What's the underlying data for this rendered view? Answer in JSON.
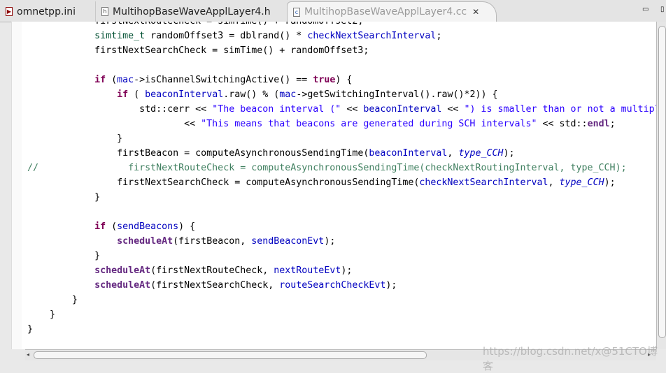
{
  "tabs": [
    {
      "label": "omnetpp.ini",
      "icon": "ini-file-icon",
      "glyph": "▶"
    },
    {
      "label": "MultihopBaseWaveApplLayer4.h",
      "icon": "header-file-icon",
      "glyph": "h"
    },
    {
      "label": "MultihopBaseWaveApplLayer4.cc",
      "icon": "cpp-file-icon",
      "glyph": "c",
      "active": true,
      "close_glyph": "✕"
    }
  ],
  "window_controls": {
    "minimize": "▭",
    "maximize": "▯"
  },
  "colors": {
    "keyword": "#7f0055",
    "field": "#0000c0",
    "string": "#2a00ff",
    "comment": "#3f7f5f",
    "type": "#005032"
  },
  "code_lines": [
    [
      [
        "",
        "            firstNextRouteCheck = simTime() + randomOffset2;"
      ]
    ],
    [
      [
        "",
        "            "
      ],
      [
        "typ",
        "simtime_t"
      ],
      [
        "",
        " randomOffset3 = dblrand() * "
      ],
      [
        "fld",
        "checkNextSearchInterval"
      ],
      [
        "",
        ";"
      ]
    ],
    [
      [
        "",
        "            firstNextSearchCheck = simTime() + randomOffset3;"
      ]
    ],
    [],
    [
      [
        "",
        "            "
      ],
      [
        "kw",
        "if"
      ],
      [
        "",
        " ("
      ],
      [
        "fld",
        "mac"
      ],
      [
        "",
        "->isChannelSwitchingActive() == "
      ],
      [
        "kw",
        "true"
      ],
      [
        "",
        ") {"
      ]
    ],
    [
      [
        "",
        "                "
      ],
      [
        "kw",
        "if"
      ],
      [
        "",
        " ( "
      ],
      [
        "fld",
        "beaconInterval"
      ],
      [
        "",
        ".raw() % ("
      ],
      [
        "fld",
        "mac"
      ],
      [
        "",
        "->getSwitchingInterval().raw()*2)) {"
      ]
    ],
    [
      [
        "",
        "                    std::cerr << "
      ],
      [
        "str",
        "\"The beacon interval (\""
      ],
      [
        "",
        " << "
      ],
      [
        "fld",
        "beaconInterval"
      ],
      [
        "",
        " << "
      ],
      [
        "str",
        "\") is smaller than or not a multiple of one synchronization interval (\""
      ]
    ],
    [
      [
        "",
        "                            << "
      ],
      [
        "str",
        "\"This means that beacons are generated during SCH intervals\""
      ],
      [
        "",
        " << std::"
      ],
      [
        "fn",
        "endl"
      ],
      [
        "",
        ";"
      ]
    ],
    [
      [
        "",
        "                }"
      ]
    ],
    [
      [
        "",
        "                firstBeacon = computeAsynchronousSendingTime("
      ],
      [
        "fld",
        "beaconInterval"
      ],
      [
        "",
        ", "
      ],
      [
        "it",
        "type_CCH"
      ],
      [
        "",
        ");"
      ]
    ],
    [
      [
        "com",
        "//                firstNextRouteCheck = computeAsynchronousSendingTime(checkNextRoutingInterval, type_CCH);"
      ]
    ],
    [
      [
        "",
        "                firstNextSearchCheck = computeAsynchronousSendingTime("
      ],
      [
        "fld",
        "checkNextSearchInterval"
      ],
      [
        "",
        ", "
      ],
      [
        "it",
        "type_CCH"
      ],
      [
        "",
        ");"
      ]
    ],
    [
      [
        "",
        "            }"
      ]
    ],
    [],
    [
      [
        "",
        "            "
      ],
      [
        "kw",
        "if"
      ],
      [
        "",
        " ("
      ],
      [
        "fld",
        "sendBeacons"
      ],
      [
        "",
        ") {"
      ]
    ],
    [
      [
        "",
        "                "
      ],
      [
        "fn",
        "scheduleAt"
      ],
      [
        "",
        "(firstBeacon, "
      ],
      [
        "fld",
        "sendBeaconEvt"
      ],
      [
        "",
        ");"
      ]
    ],
    [
      [
        "",
        "            }"
      ]
    ],
    [
      [
        "",
        "            "
      ],
      [
        "fn",
        "scheduleAt"
      ],
      [
        "",
        "(firstNextRouteCheck, "
      ],
      [
        "fld",
        "nextRouteEvt"
      ],
      [
        "",
        ");"
      ]
    ],
    [
      [
        "",
        "            "
      ],
      [
        "fn",
        "scheduleAt"
      ],
      [
        "",
        "(firstNextSearchCheck, "
      ],
      [
        "fld",
        "routeSearchCheckEvt"
      ],
      [
        "",
        ");"
      ]
    ],
    [
      [
        "",
        "        }"
      ]
    ],
    [
      [
        "",
        "    }"
      ]
    ],
    [
      [
        "",
        "}"
      ]
    ]
  ],
  "watermark": "https://blog.csdn.net/x@51CTO博客"
}
